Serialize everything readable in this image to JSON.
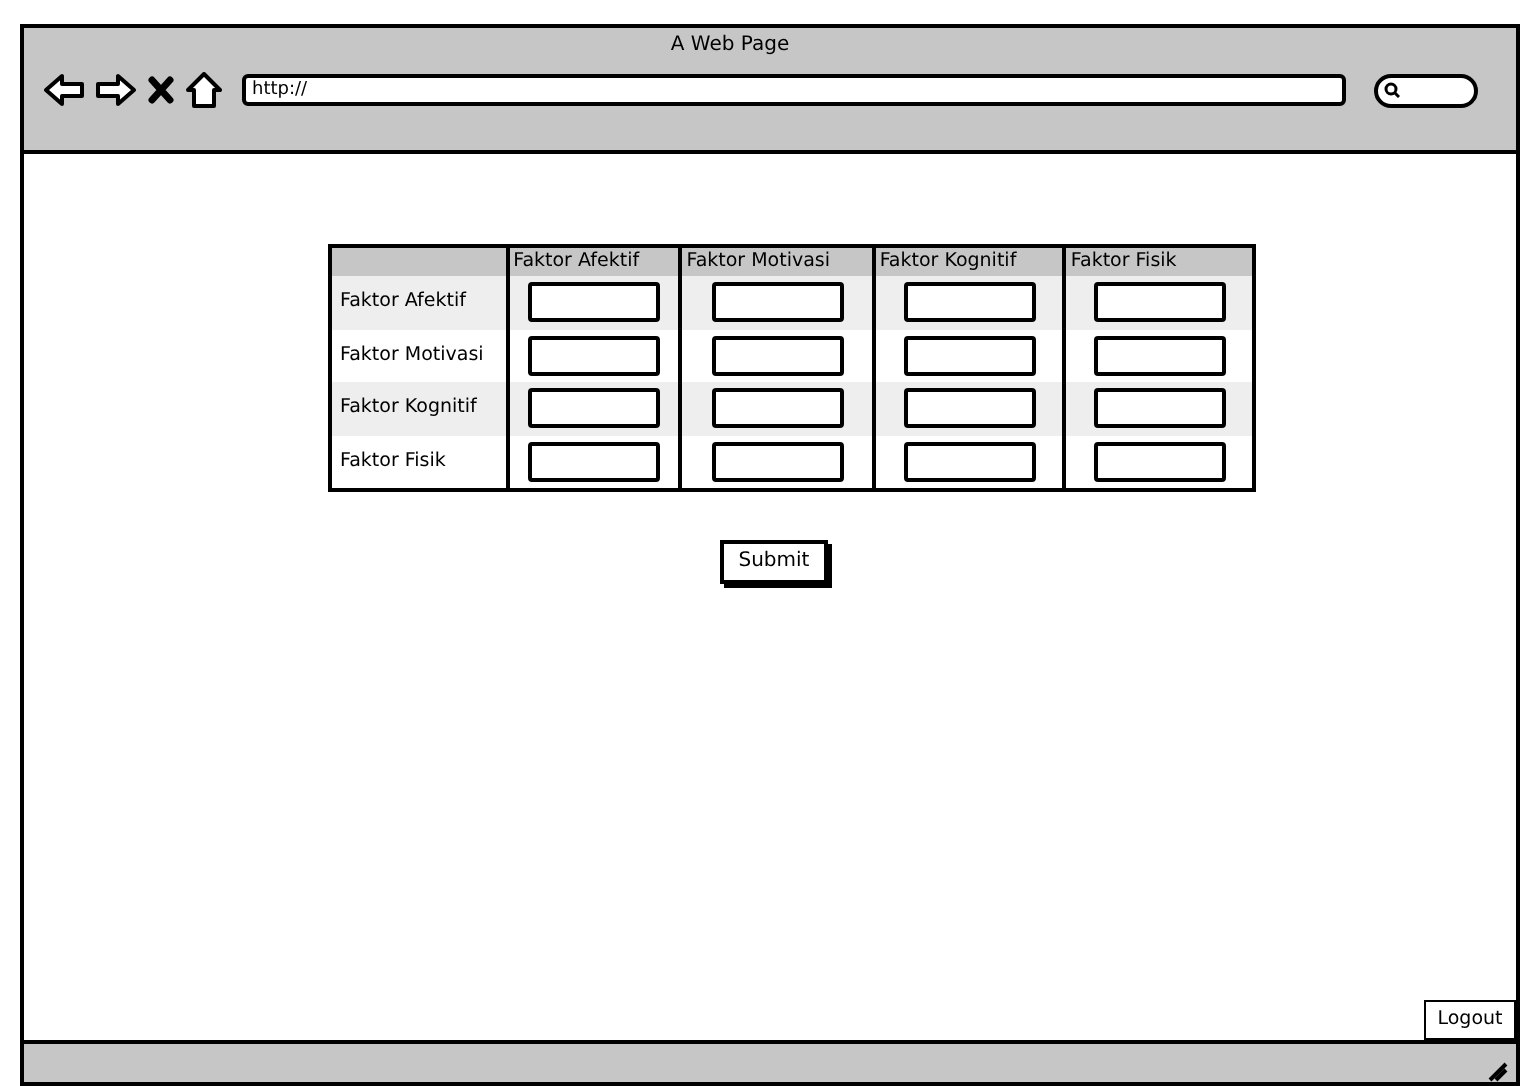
{
  "window": {
    "title": "A Web Page"
  },
  "address_bar": {
    "value": "http://"
  },
  "table": {
    "columns": [
      "Faktor Afektif",
      "Faktor Motivasi",
      "Faktor Kognitif",
      "Faktor Fisik"
    ],
    "rows": [
      {
        "label": "Faktor Afektif"
      },
      {
        "label": "Faktor Motivasi"
      },
      {
        "label": "Faktor Kognitif"
      },
      {
        "label": "Faktor Fisik"
      }
    ]
  },
  "submit_button": "Submit",
  "logout_button": "Logout"
}
